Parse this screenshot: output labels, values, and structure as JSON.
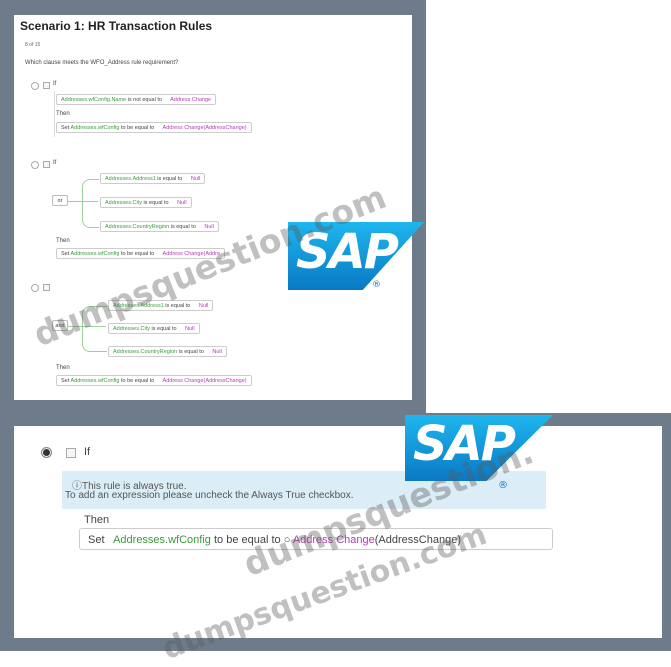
{
  "screen1": {
    "title": "Scenario 1: HR Transaction Rules",
    "counter": "8 of 15",
    "question": "Which clause meets the WFO_Address rule requirement?",
    "if_label": "If",
    "then_label": "Then",
    "option_a": {
      "condition": {
        "field": "Addresses.wfConfig.Name",
        "operator": "is not equal to",
        "value": "Address Change"
      },
      "action": {
        "set": "Set",
        "field": "Addresses.wfConfig",
        "operator": "to be equal to",
        "value": "Address Change(AddressChange)"
      }
    },
    "option_b": {
      "join": "or",
      "conditions": [
        {
          "field": "Addresses.Address1",
          "operator": "is equal to",
          "value": "Null"
        },
        {
          "field": "Addresses.City",
          "operator": "is equal to",
          "value": "Null"
        },
        {
          "field": "Addresses.CountryRegion",
          "operator": "is equal to",
          "value": "Null"
        }
      ],
      "action": {
        "set": "Set",
        "field": "Addresses.wfConfig",
        "operator": "to be equal to",
        "value": "Address Change(Addre"
      }
    },
    "option_c": {
      "join": "and",
      "conditions": [
        {
          "field": "Addresses.Address1",
          "operator": "is equal to",
          "value": "Null"
        },
        {
          "field": "Addresses.City",
          "operator": "is equal to",
          "value": "Null"
        },
        {
          "field": "Addresses.CountryRegion",
          "operator": "is equal to",
          "value": "Null"
        }
      ],
      "action": {
        "set": "Set",
        "field": "Addresses.wfConfig",
        "operator": "to be equal to",
        "value": "Address Change(AddressChange)"
      }
    }
  },
  "screen2": {
    "if_label": "If",
    "info_line1": "This rule is always true.",
    "info_line2": "To add an expression please uncheck the Always True checkbox.",
    "then_label": "Then",
    "action": {
      "set": "Set",
      "field": "Addresses.wfConfig",
      "operator": "to be equal to",
      "value": "Address Change",
      "param": "(AddressChange)"
    }
  },
  "logo": {
    "text": "SAP",
    "reg": "®"
  },
  "watermark": {
    "line1": "dumpsquestion.com",
    "line2": "dumpsquestion.",
    "line3": "dumpsquestion.com"
  },
  "colors": {
    "field": "#3c9a3c",
    "value": "#b33db3",
    "frame": "#6e7b8b",
    "info_bg": "#dbeef7",
    "sap_blue": "#0a79c4"
  }
}
